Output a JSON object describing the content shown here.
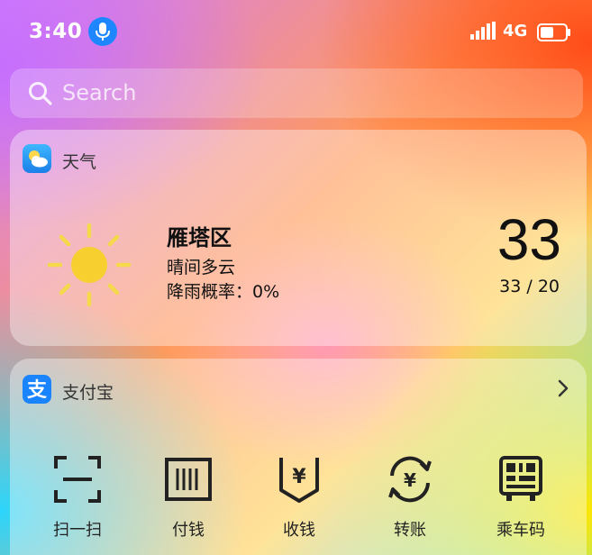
{
  "status_bar": {
    "time": "3:40",
    "network": "4G",
    "icons": [
      "mic-icon",
      "signal-icon",
      "battery-icon"
    ]
  },
  "search": {
    "placeholder": "Search",
    "icon": "search-icon"
  },
  "weather_widget": {
    "app_name": "天气",
    "icon": "weather-app-icon",
    "condition_icon": "sun-icon",
    "location": "雁塔区",
    "condition": "晴间多云",
    "rain_chance": "降雨概率：0%",
    "temperature": "33",
    "temp_range": "33 / 20"
  },
  "alipay_widget": {
    "app_name": "支付宝",
    "icon": "alipay-icon",
    "chevron": "chevron-right-icon",
    "actions": [
      {
        "label": "扫一扫",
        "icon": "scan-icon"
      },
      {
        "label": "付钱",
        "icon": "barcode-pay-icon"
      },
      {
        "label": "收钱",
        "icon": "receive-money-icon"
      },
      {
        "label": "转账",
        "icon": "transfer-icon"
      },
      {
        "label": "乘车码",
        "icon": "transit-code-icon"
      }
    ]
  },
  "colors": {
    "mic_badge": "#1e87ff",
    "alipay_blue": "#1a84ff",
    "sun": "#f7cf2e",
    "sun_rays": "#f6d94a",
    "icon_stroke": "#222222"
  }
}
